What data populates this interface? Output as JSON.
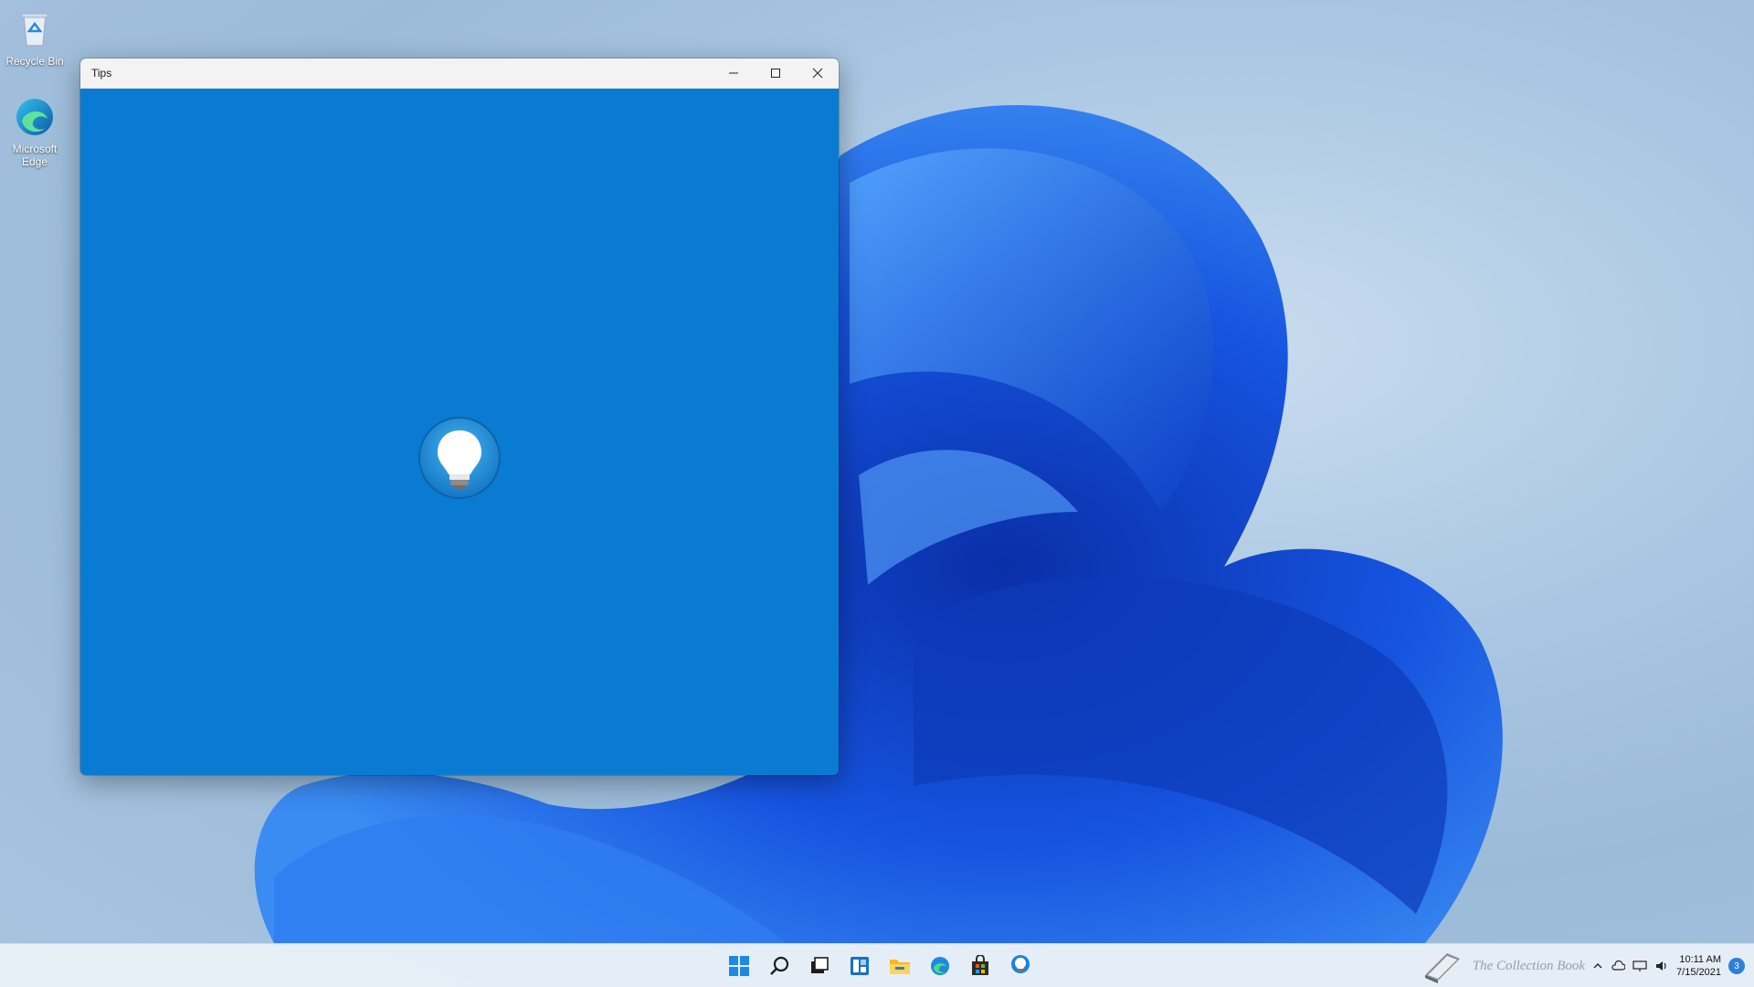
{
  "desktop": {
    "icons": [
      {
        "label": "Recycle Bin",
        "icon": "recycle-bin-icon"
      },
      {
        "label": "Microsoft Edge",
        "icon": "edge-icon"
      }
    ]
  },
  "window": {
    "title": "Tips",
    "buttons": [
      "minimize-icon",
      "maximize-icon",
      "close-icon"
    ],
    "splash_icon": "lightbulb-icon",
    "background": "#0a7bd3"
  },
  "taskbar": {
    "apps": [
      "start-icon",
      "search-icon",
      "task-view-icon",
      "widgets-icon",
      "file-explorer-icon",
      "edge-icon",
      "store-icon",
      "tips-icon"
    ],
    "tray": {
      "watermark": "The Collection Book",
      "time": "10:11 AM",
      "date": "7/15/2021",
      "notification_count": "3"
    }
  },
  "colors": {
    "accent": "#0a7bd3",
    "taskbar": "#e8eff7"
  }
}
